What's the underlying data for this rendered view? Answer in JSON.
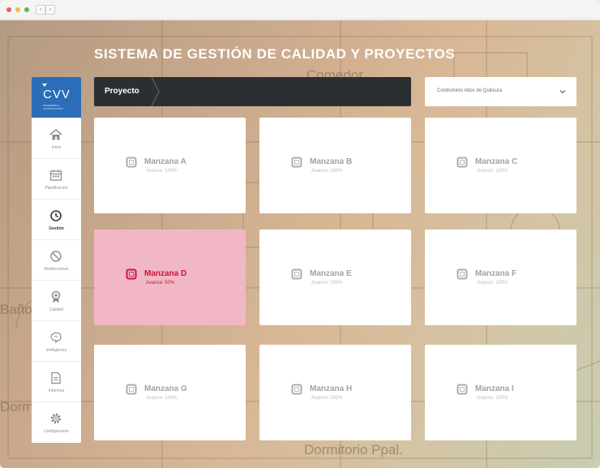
{
  "title": "SISTEMA DE GESTIÓN DE CALIDAD Y PROYECTOS",
  "brand": {
    "logo": "CVV",
    "subtitle": "INGENIERÍA & CONSTRUCCIÓN"
  },
  "sidebar": {
    "items": [
      {
        "label": "Inicio",
        "icon": "home-icon",
        "active": false
      },
      {
        "label": "Planificación",
        "icon": "calendar-icon",
        "active": false
      },
      {
        "label": "Gestión",
        "icon": "clock-icon",
        "active": true
      },
      {
        "label": "Restricciones",
        "icon": "block-icon",
        "active": false
      },
      {
        "label": "Calidad",
        "icon": "award-icon",
        "active": false
      },
      {
        "label": "Inteligencia",
        "icon": "brain-icon",
        "active": false
      },
      {
        "label": "Informes",
        "icon": "document-icon",
        "active": false
      },
      {
        "label": "Configuración",
        "icon": "gear-icon",
        "active": false
      }
    ]
  },
  "breadcrumb": {
    "label": "Proyecto"
  },
  "project_select": {
    "value": "Condominio Altos de Quilicura"
  },
  "cards": [
    {
      "name": "Manzana A",
      "progress": "Avance: 100%",
      "active": false
    },
    {
      "name": "Manzana B",
      "progress": "Avance: 100%",
      "active": false
    },
    {
      "name": "Manzana C",
      "progress": "Avance: 100%",
      "active": false
    },
    {
      "name": "Manzana D",
      "progress": "Avance: 50%",
      "active": true
    },
    {
      "name": "Manzana E",
      "progress": "Avance: 100%",
      "active": false
    },
    {
      "name": "Manzana F",
      "progress": "Avance: 100%",
      "active": false
    },
    {
      "name": "Manzana G",
      "progress": "Avance: 100%",
      "active": false
    },
    {
      "name": "Manzana H",
      "progress": "Avance: 100%",
      "active": false
    },
    {
      "name": "Manzana I",
      "progress": "Avance: 100%",
      "active": false
    }
  ],
  "background_labels": [
    "Comedor",
    "Baño",
    "Dorm",
    "Dormitorio Ppal."
  ],
  "colors": {
    "brand": "#2b6db8",
    "active_card": "#f1b7c6",
    "active_text": "#d1133b",
    "bar": "#2c2f31"
  }
}
